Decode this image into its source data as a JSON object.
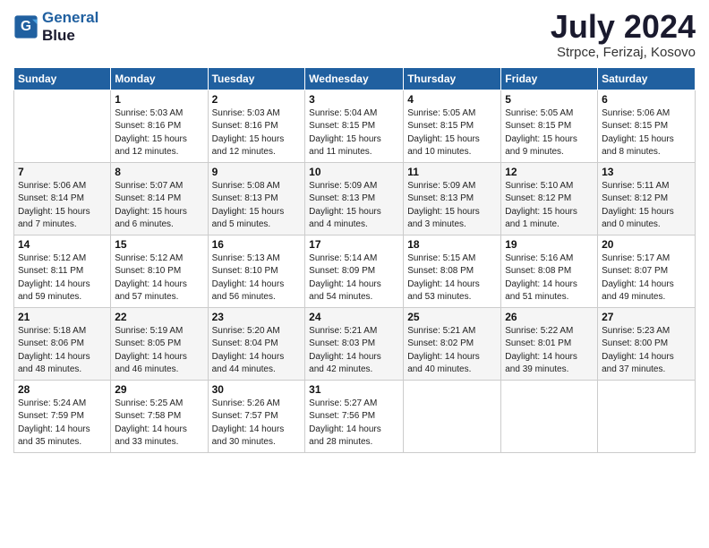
{
  "header": {
    "logo_line1": "General",
    "logo_line2": "Blue",
    "title": "July 2024",
    "location": "Strpce, Ferizaj, Kosovo"
  },
  "columns": [
    "Sunday",
    "Monday",
    "Tuesday",
    "Wednesday",
    "Thursday",
    "Friday",
    "Saturday"
  ],
  "weeks": [
    [
      {
        "num": "",
        "info": ""
      },
      {
        "num": "1",
        "info": "Sunrise: 5:03 AM\nSunset: 8:16 PM\nDaylight: 15 hours\nand 12 minutes."
      },
      {
        "num": "2",
        "info": "Sunrise: 5:03 AM\nSunset: 8:16 PM\nDaylight: 15 hours\nand 12 minutes."
      },
      {
        "num": "3",
        "info": "Sunrise: 5:04 AM\nSunset: 8:15 PM\nDaylight: 15 hours\nand 11 minutes."
      },
      {
        "num": "4",
        "info": "Sunrise: 5:05 AM\nSunset: 8:15 PM\nDaylight: 15 hours\nand 10 minutes."
      },
      {
        "num": "5",
        "info": "Sunrise: 5:05 AM\nSunset: 8:15 PM\nDaylight: 15 hours\nand 9 minutes."
      },
      {
        "num": "6",
        "info": "Sunrise: 5:06 AM\nSunset: 8:15 PM\nDaylight: 15 hours\nand 8 minutes."
      }
    ],
    [
      {
        "num": "7",
        "info": "Sunrise: 5:06 AM\nSunset: 8:14 PM\nDaylight: 15 hours\nand 7 minutes."
      },
      {
        "num": "8",
        "info": "Sunrise: 5:07 AM\nSunset: 8:14 PM\nDaylight: 15 hours\nand 6 minutes."
      },
      {
        "num": "9",
        "info": "Sunrise: 5:08 AM\nSunset: 8:13 PM\nDaylight: 15 hours\nand 5 minutes."
      },
      {
        "num": "10",
        "info": "Sunrise: 5:09 AM\nSunset: 8:13 PM\nDaylight: 15 hours\nand 4 minutes."
      },
      {
        "num": "11",
        "info": "Sunrise: 5:09 AM\nSunset: 8:13 PM\nDaylight: 15 hours\nand 3 minutes."
      },
      {
        "num": "12",
        "info": "Sunrise: 5:10 AM\nSunset: 8:12 PM\nDaylight: 15 hours\nand 1 minute."
      },
      {
        "num": "13",
        "info": "Sunrise: 5:11 AM\nSunset: 8:12 PM\nDaylight: 15 hours\nand 0 minutes."
      }
    ],
    [
      {
        "num": "14",
        "info": "Sunrise: 5:12 AM\nSunset: 8:11 PM\nDaylight: 14 hours\nand 59 minutes."
      },
      {
        "num": "15",
        "info": "Sunrise: 5:12 AM\nSunset: 8:10 PM\nDaylight: 14 hours\nand 57 minutes."
      },
      {
        "num": "16",
        "info": "Sunrise: 5:13 AM\nSunset: 8:10 PM\nDaylight: 14 hours\nand 56 minutes."
      },
      {
        "num": "17",
        "info": "Sunrise: 5:14 AM\nSunset: 8:09 PM\nDaylight: 14 hours\nand 54 minutes."
      },
      {
        "num": "18",
        "info": "Sunrise: 5:15 AM\nSunset: 8:08 PM\nDaylight: 14 hours\nand 53 minutes."
      },
      {
        "num": "19",
        "info": "Sunrise: 5:16 AM\nSunset: 8:08 PM\nDaylight: 14 hours\nand 51 minutes."
      },
      {
        "num": "20",
        "info": "Sunrise: 5:17 AM\nSunset: 8:07 PM\nDaylight: 14 hours\nand 49 minutes."
      }
    ],
    [
      {
        "num": "21",
        "info": "Sunrise: 5:18 AM\nSunset: 8:06 PM\nDaylight: 14 hours\nand 48 minutes."
      },
      {
        "num": "22",
        "info": "Sunrise: 5:19 AM\nSunset: 8:05 PM\nDaylight: 14 hours\nand 46 minutes."
      },
      {
        "num": "23",
        "info": "Sunrise: 5:20 AM\nSunset: 8:04 PM\nDaylight: 14 hours\nand 44 minutes."
      },
      {
        "num": "24",
        "info": "Sunrise: 5:21 AM\nSunset: 8:03 PM\nDaylight: 14 hours\nand 42 minutes."
      },
      {
        "num": "25",
        "info": "Sunrise: 5:21 AM\nSunset: 8:02 PM\nDaylight: 14 hours\nand 40 minutes."
      },
      {
        "num": "26",
        "info": "Sunrise: 5:22 AM\nSunset: 8:01 PM\nDaylight: 14 hours\nand 39 minutes."
      },
      {
        "num": "27",
        "info": "Sunrise: 5:23 AM\nSunset: 8:00 PM\nDaylight: 14 hours\nand 37 minutes."
      }
    ],
    [
      {
        "num": "28",
        "info": "Sunrise: 5:24 AM\nSunset: 7:59 PM\nDaylight: 14 hours\nand 35 minutes."
      },
      {
        "num": "29",
        "info": "Sunrise: 5:25 AM\nSunset: 7:58 PM\nDaylight: 14 hours\nand 33 minutes."
      },
      {
        "num": "30",
        "info": "Sunrise: 5:26 AM\nSunset: 7:57 PM\nDaylight: 14 hours\nand 30 minutes."
      },
      {
        "num": "31",
        "info": "Sunrise: 5:27 AM\nSunset: 7:56 PM\nDaylight: 14 hours\nand 28 minutes."
      },
      {
        "num": "",
        "info": ""
      },
      {
        "num": "",
        "info": ""
      },
      {
        "num": "",
        "info": ""
      }
    ]
  ]
}
